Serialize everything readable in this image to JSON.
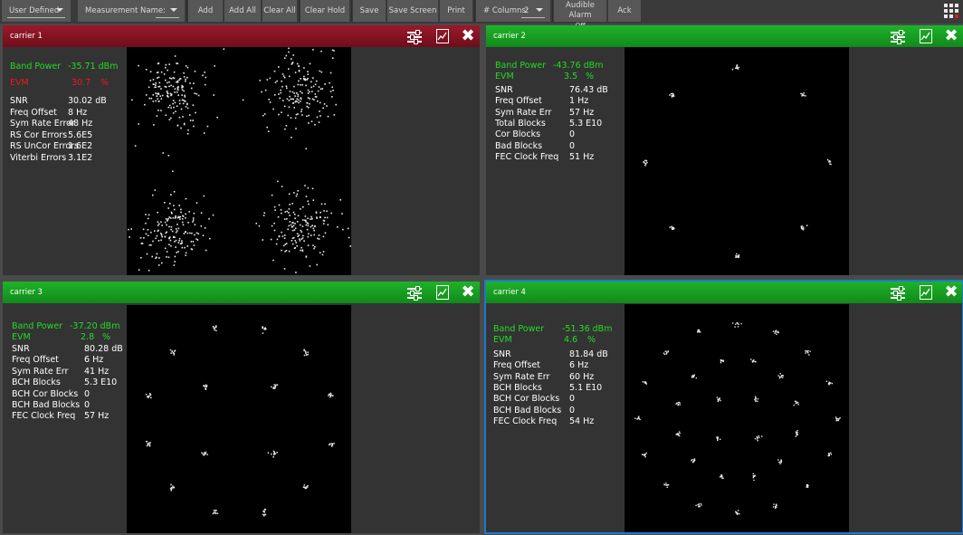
{
  "toolbar": {
    "user_defined": "User Defined",
    "measurement_name": "Measurement Name:",
    "add": "Add",
    "add_all": "Add All",
    "clear_all": "Clear All",
    "clear_hold": "Clear Hold",
    "save": "Save",
    "save_screen": "Save Screen",
    "print": "Print",
    "columns_label": "# Columns:",
    "columns_value": "2",
    "audible_alarm": "Audible Alarm",
    "audible_alarm_state": "Off",
    "ack": "Ack"
  },
  "panels": [
    {
      "title": "carrier 1",
      "band_power_label": "Band Power",
      "band_power": "-35.71 dBm",
      "evm_label": "EVM",
      "evm": "30.7",
      "evm_unit": "%",
      "rows": [
        {
          "label": "SNR",
          "value": "30.02 dB"
        },
        {
          "label": "Freq Offset",
          "value": "8       Hz"
        },
        {
          "label": "Sym Rate Error",
          "value": "48 Hz"
        },
        {
          "label": "RS Cor Errors",
          "value": "5.6E5"
        },
        {
          "label": "RS UnCor Errors",
          "value": "1.6E2"
        },
        {
          "label": "Viterbi Errors",
          "value": "3.1E2"
        }
      ]
    },
    {
      "title": "carrier 2",
      "band_power_label": "Band Power",
      "band_power": "-43.76 dBm",
      "evm_label": "EVM",
      "evm": "3.5",
      "evm_unit": "%",
      "rows": [
        {
          "label": "SNR",
          "value": "76.43 dB"
        },
        {
          "label": "Freq Offset",
          "value": "1      Hz"
        },
        {
          "label": "Sym Rate Err",
          "value": "57    Hz"
        },
        {
          "label": "Total Blocks",
          "value": "5.3 E10"
        },
        {
          "label": "Cor Blocks",
          "value": "0"
        },
        {
          "label": "Bad Blocks",
          "value": "0"
        },
        {
          "label": "FEC Clock Freq",
          "value": "51 Hz"
        }
      ]
    },
    {
      "title": "carrier 3",
      "band_power_label": "Band Power",
      "band_power": "-37.20 dBm",
      "evm_label": "EVM",
      "evm": "2.8",
      "evm_unit": "%",
      "rows": [
        {
          "label": "SNR",
          "value": "80.28 dB"
        },
        {
          "label": "Freq Offset",
          "value": "6       Hz"
        },
        {
          "label": "Sym Rate Err",
          "value": "41     Hz"
        },
        {
          "label": "BCH Blocks",
          "value": "5.3 E10"
        },
        {
          "label": "BCH Cor Blocks",
          "value": "0"
        },
        {
          "label": "BCH Bad Blocks",
          "value": "0"
        },
        {
          "label": "FEC Clock Freq",
          "value": "57 Hz"
        }
      ]
    },
    {
      "title": "carrier 4",
      "band_power_label": "Band Power",
      "band_power": "-51.36 dBm",
      "evm_label": "EVM",
      "evm": "4.6",
      "evm_unit": "%",
      "rows": [
        {
          "label": "SNR",
          "value": "81.84 dB"
        },
        {
          "label": "Freq Offset",
          "value": "6      Hz"
        },
        {
          "label": "Sym Rate Err",
          "value": "60    Hz"
        },
        {
          "label": "BCH Blocks",
          "value": "5.1 E10"
        },
        {
          "label": "BCH Cor Blocks",
          "value": "0"
        },
        {
          "label": "BCH Bad Blocks",
          "value": "0"
        },
        {
          "label": "FEC Clock Freq",
          "value": "54 Hz"
        }
      ]
    }
  ],
  "colors": {
    "header_red": "#8a1424",
    "header_green": "#18a022",
    "band_power": "#22dd22",
    "evm_bad": "#ee1a1a",
    "selected_outline": "#1a7ad0"
  }
}
